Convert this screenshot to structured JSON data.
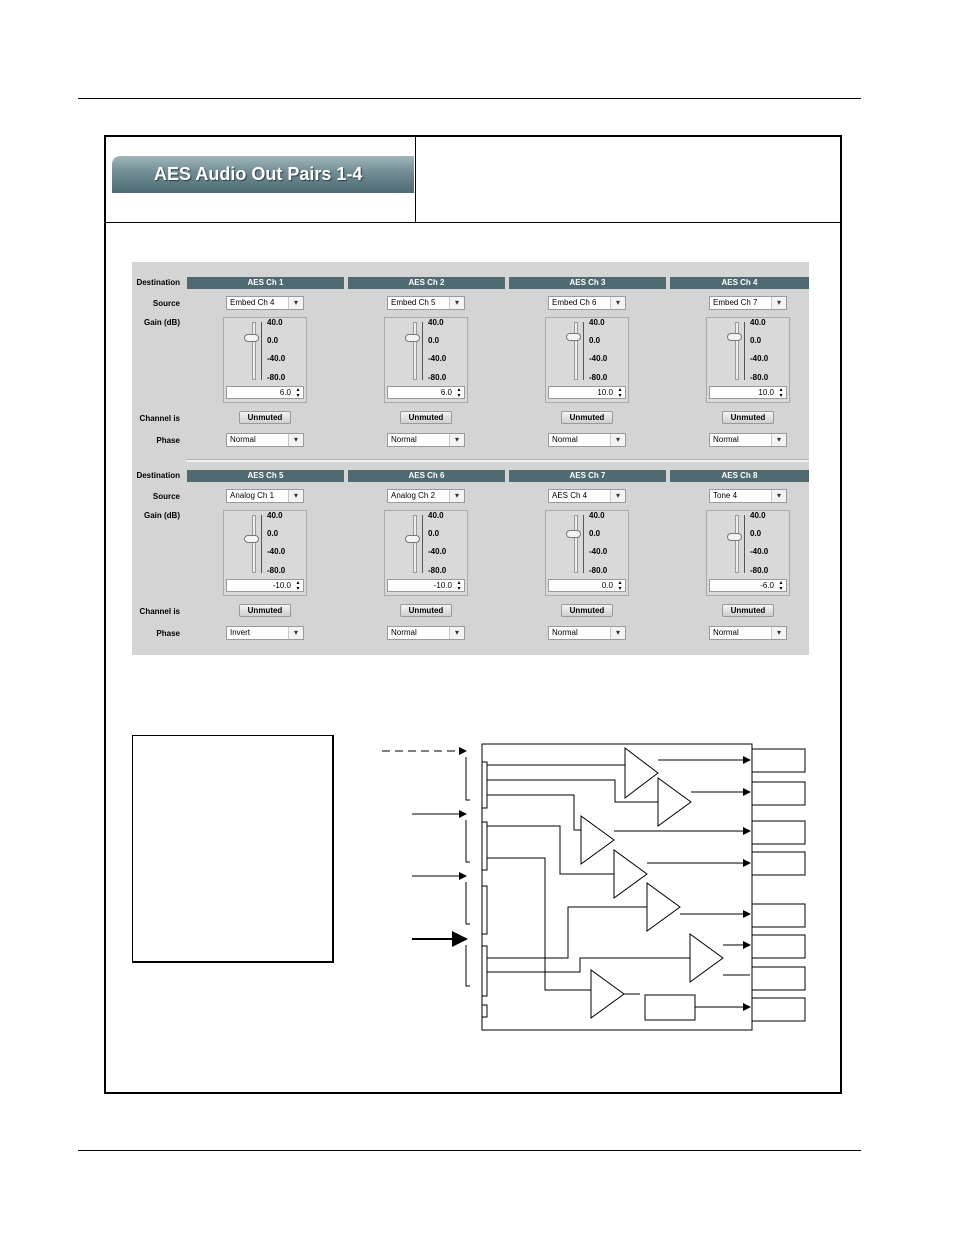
{
  "banner": {
    "title": "AES Audio Out Pairs 1-4"
  },
  "labels": {
    "destination": "Destination",
    "source": "Source",
    "gain": "Gain (dB)",
    "channel_is": "Channel is",
    "phase": "Phase"
  },
  "scale": [
    "40.0",
    "0.0",
    "-40.0",
    "-80.0"
  ],
  "groups": [
    {
      "channels": [
        {
          "dest": "AES Ch 1",
          "source": "Embed Ch 4",
          "gain": "6.0",
          "gain_level": 6.0,
          "mute": "Unmuted",
          "phase": "Normal"
        },
        {
          "dest": "AES Ch 2",
          "source": "Embed Ch 5",
          "gain": "6.0",
          "gain_level": 6.0,
          "mute": "Unmuted",
          "phase": "Normal"
        },
        {
          "dest": "AES Ch 3",
          "source": "Embed Ch 6",
          "gain": "10.0",
          "gain_level": 10.0,
          "mute": "Unmuted",
          "phase": "Normal"
        },
        {
          "dest": "AES Ch 4",
          "source": "Embed Ch 7",
          "gain": "10.0",
          "gain_level": 10.0,
          "mute": "Unmuted",
          "phase": "Normal"
        }
      ]
    },
    {
      "channels": [
        {
          "dest": "AES Ch 5",
          "source": "Analog Ch 1",
          "gain": "-10.0",
          "gain_level": -10.0,
          "mute": "Unmuted",
          "phase": "Invert"
        },
        {
          "dest": "AES Ch 6",
          "source": "Analog Ch 2",
          "gain": "-10.0",
          "gain_level": -10.0,
          "mute": "Unmuted",
          "phase": "Normal"
        },
        {
          "dest": "AES Ch 7",
          "source": "AES Ch 4",
          "gain": "0.0",
          "gain_level": 0.0,
          "mute": "Unmuted",
          "phase": "Normal"
        },
        {
          "dest": "AES Ch 8",
          "source": "Tone 4",
          "gain": "-6.0",
          "gain_level": -6.0,
          "mute": "Unmuted",
          "phase": "Normal"
        }
      ]
    }
  ],
  "colors": {
    "header": "#4f6b71",
    "panel": "#d4d4d4",
    "banner": "#5f7c82"
  }
}
